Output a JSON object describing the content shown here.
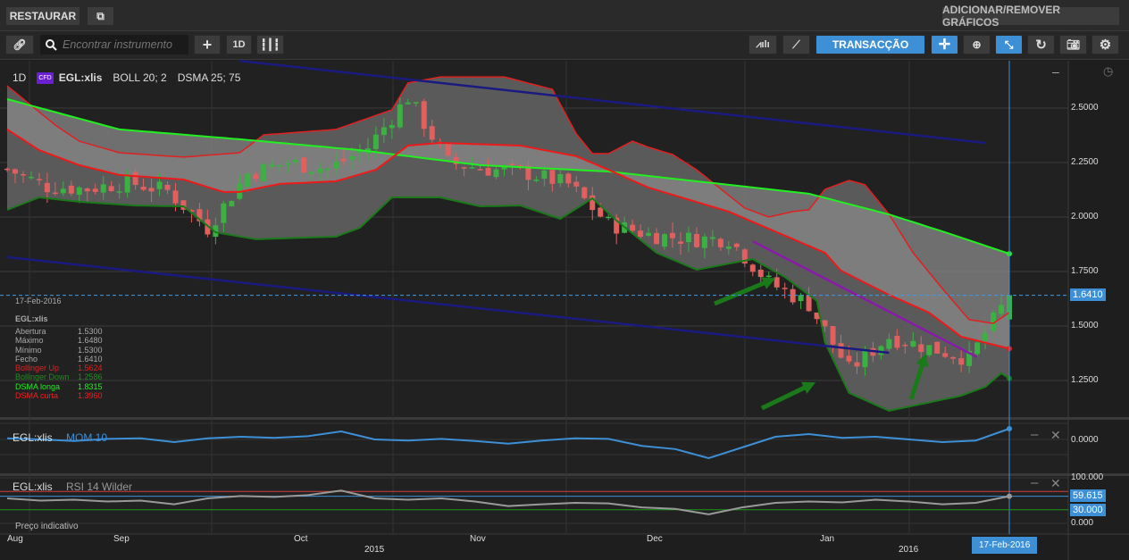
{
  "topbar": {
    "restore_label": "RESTAURAR",
    "add_remove_label": "ADICIONAR/REMOVER GRÁFICOS"
  },
  "toolbar": {
    "search_placeholder": "Encontrar instrumento",
    "interval_label": "1D",
    "trade_label": "TRANSACÇÃO"
  },
  "legend": {
    "interval": "1D",
    "badge": "CFD",
    "symbol": "EGL:xlis",
    "boll": "BOLL 20; 2",
    "dsma": "DSMA 25; 75"
  },
  "info": {
    "date": "17-Feb-2016",
    "symbol": "EGL:xlis",
    "rows": [
      {
        "label": "Abertura",
        "value": "1.5300",
        "color": "#aaaaaa"
      },
      {
        "label": "Máximo",
        "value": "1.6480",
        "color": "#aaaaaa"
      },
      {
        "label": "Mínimo",
        "value": "1.5300",
        "color": "#aaaaaa"
      },
      {
        "label": "Fecho",
        "value": "1.6410",
        "color": "#aaaaaa"
      },
      {
        "label": "Bollinger Up",
        "value": "1.5624",
        "color": "#e02020"
      },
      {
        "label": "Bollinger Down",
        "value": "1.2586",
        "color": "#1f8a1f"
      },
      {
        "label": "DSMA longa",
        "value": "1.8315",
        "color": "#22ee22"
      },
      {
        "label": "DSMA curta",
        "value": "1.3960",
        "color": "#ee2020"
      }
    ]
  },
  "price_axis": {
    "ticks": [
      "2.5000",
      "2.2500",
      "2.0000",
      "1.7500",
      "1.5000",
      "1.2500"
    ],
    "current": "1.6410"
  },
  "mom_panel": {
    "symbol": "EGL:xlis",
    "name": "MOM 10",
    "tick": "0.0000"
  },
  "rsi_panel": {
    "symbol": "EGL:xlis",
    "name": "RSI 14 Wilder",
    "ticks": [
      "100.000",
      "0.000"
    ],
    "current": "59.615",
    "level": "30.000"
  },
  "footer": {
    "indicative": "Preço indicativo",
    "months": [
      "Aug",
      "Sep",
      "Oct",
      "Nov",
      "Dec",
      "Jan"
    ],
    "years": [
      "2015",
      "2016"
    ],
    "cursor_date": "17-Feb-2016"
  },
  "colors": {
    "accent": "#3d8fd6",
    "up": "#3cb043",
    "down": "#e06060"
  },
  "chart_data": {
    "type": "candlestick",
    "x_unit": "trading day index",
    "ylim": [
      1.05,
      2.7
    ],
    "close_path": [
      2.22,
      2.14,
      2.13,
      2.16,
      2.12,
      1.95,
      2.2,
      2.25,
      2.22,
      2.32,
      2.55,
      2.25,
      2.22,
      2.2,
      2.15,
      1.97,
      1.92,
      1.9,
      1.9,
      1.7,
      1.6,
      1.3,
      1.45,
      1.4,
      1.35,
      1.641
    ],
    "last_candle": {
      "open": 1.53,
      "high": 1.648,
      "low": 1.53,
      "close": 1.641
    },
    "boll_up": [
      [
        0,
        2.602
      ],
      [
        6,
        2.422
      ],
      [
        9,
        2.348
      ],
      [
        14,
        2.295
      ],
      [
        22,
        2.275
      ],
      [
        29,
        2.295
      ],
      [
        32,
        2.377
      ],
      [
        41,
        2.402
      ],
      [
        48,
        2.492
      ],
      [
        50,
        2.615
      ],
      [
        54,
        2.643
      ],
      [
        62,
        2.643
      ],
      [
        68,
        2.586
      ],
      [
        71,
        2.381
      ],
      [
        73,
        2.291
      ],
      [
        75,
        2.291
      ],
      [
        78,
        2.348
      ],
      [
        80,
        2.32
      ],
      [
        83,
        2.287
      ],
      [
        86,
        2.217
      ],
      [
        92,
        2.041
      ],
      [
        95,
        2.0
      ],
      [
        98,
        2.025
      ],
      [
        100,
        2.033
      ],
      [
        102,
        2.127
      ],
      [
        105,
        2.168
      ],
      [
        107,
        2.148
      ],
      [
        110,
        2.012
      ],
      [
        113,
        1.836
      ],
      [
        117,
        1.656
      ],
      [
        120,
        1.529
      ],
      [
        123,
        1.512
      ],
      [
        125,
        1.562
      ]
    ],
    "boll_down": [
      [
        0,
        2.033
      ],
      [
        4,
        2.09
      ],
      [
        9,
        2.07
      ],
      [
        16,
        2.053
      ],
      [
        22,
        2.049
      ],
      [
        26,
        1.93
      ],
      [
        31,
        1.898
      ],
      [
        41,
        1.91
      ],
      [
        44,
        1.951
      ],
      [
        48,
        2.09
      ],
      [
        54,
        2.09
      ],
      [
        59,
        2.049
      ],
      [
        64,
        2.053
      ],
      [
        69,
        1.992
      ],
      [
        73,
        2.086
      ],
      [
        76,
        1.984
      ],
      [
        81,
        1.836
      ],
      [
        86,
        1.758
      ],
      [
        93,
        1.807
      ],
      [
        97,
        1.725
      ],
      [
        101,
        1.615
      ],
      [
        102,
        1.426
      ],
      [
        105,
        1.193
      ],
      [
        110,
        1.111
      ],
      [
        119,
        1.18
      ],
      [
        122,
        1.221
      ],
      [
        124,
        1.283
      ],
      [
        125,
        1.259
      ]
    ],
    "dsma_short": [
      [
        0,
        2.402
      ],
      [
        4,
        2.307
      ],
      [
        9,
        2.238
      ],
      [
        14,
        2.193
      ],
      [
        22,
        2.172
      ],
      [
        27,
        2.115
      ],
      [
        29,
        2.115
      ],
      [
        34,
        2.152
      ],
      [
        41,
        2.164
      ],
      [
        46,
        2.217
      ],
      [
        50,
        2.328
      ],
      [
        54,
        2.34
      ],
      [
        64,
        2.328
      ],
      [
        71,
        2.279
      ],
      [
        75,
        2.217
      ],
      [
        80,
        2.135
      ],
      [
        90,
        2.025
      ],
      [
        102,
        1.836
      ],
      [
        104,
        1.754
      ],
      [
        110,
        1.643
      ],
      [
        115,
        1.561
      ],
      [
        119,
        1.451
      ],
      [
        125,
        1.396
      ]
    ],
    "dsma_long": [
      [
        0,
        2.541
      ],
      [
        14,
        2.402
      ],
      [
        29,
        2.357
      ],
      [
        44,
        2.307
      ],
      [
        59,
        2.238
      ],
      [
        75,
        2.209
      ],
      [
        100,
        2.107
      ],
      [
        110,
        2.012
      ],
      [
        117,
        1.93
      ],
      [
        125,
        1.8315
      ]
    ],
    "trendlines": [
      {
        "color": "#1a1a80",
        "points": [
          [
            29,
            2.717
          ],
          [
            122,
            2.34
          ]
        ]
      },
      {
        "color": "#1a1a80",
        "points": [
          [
            0,
            1.816
          ],
          [
            110,
            1.377
          ]
        ]
      },
      {
        "color": "#8a1aaa",
        "points": [
          [
            93,
            1.889
          ],
          [
            121,
            1.357
          ]
        ]
      }
    ],
    "mom": [
      0.02,
      0.0,
      -0.03,
      0.01,
      0.02,
      -0.05,
      0.02,
      0.05,
      0.03,
      0.06,
      0.15,
      0.0,
      -0.02,
      0.01,
      -0.03,
      -0.08,
      -0.02,
      0.02,
      0.01,
      -0.12,
      -0.18,
      -0.35,
      -0.15,
      0.05,
      0.1,
      0.03,
      0.05,
      0.0,
      -0.05,
      -0.02,
      0.2
    ],
    "rsi": [
      55,
      50,
      52,
      48,
      50,
      42,
      55,
      60,
      58,
      62,
      72,
      55,
      52,
      55,
      48,
      38,
      42,
      45,
      44,
      35,
      32,
      20,
      35,
      45,
      48,
      46,
      52,
      48,
      42,
      45,
      59.6
    ]
  }
}
